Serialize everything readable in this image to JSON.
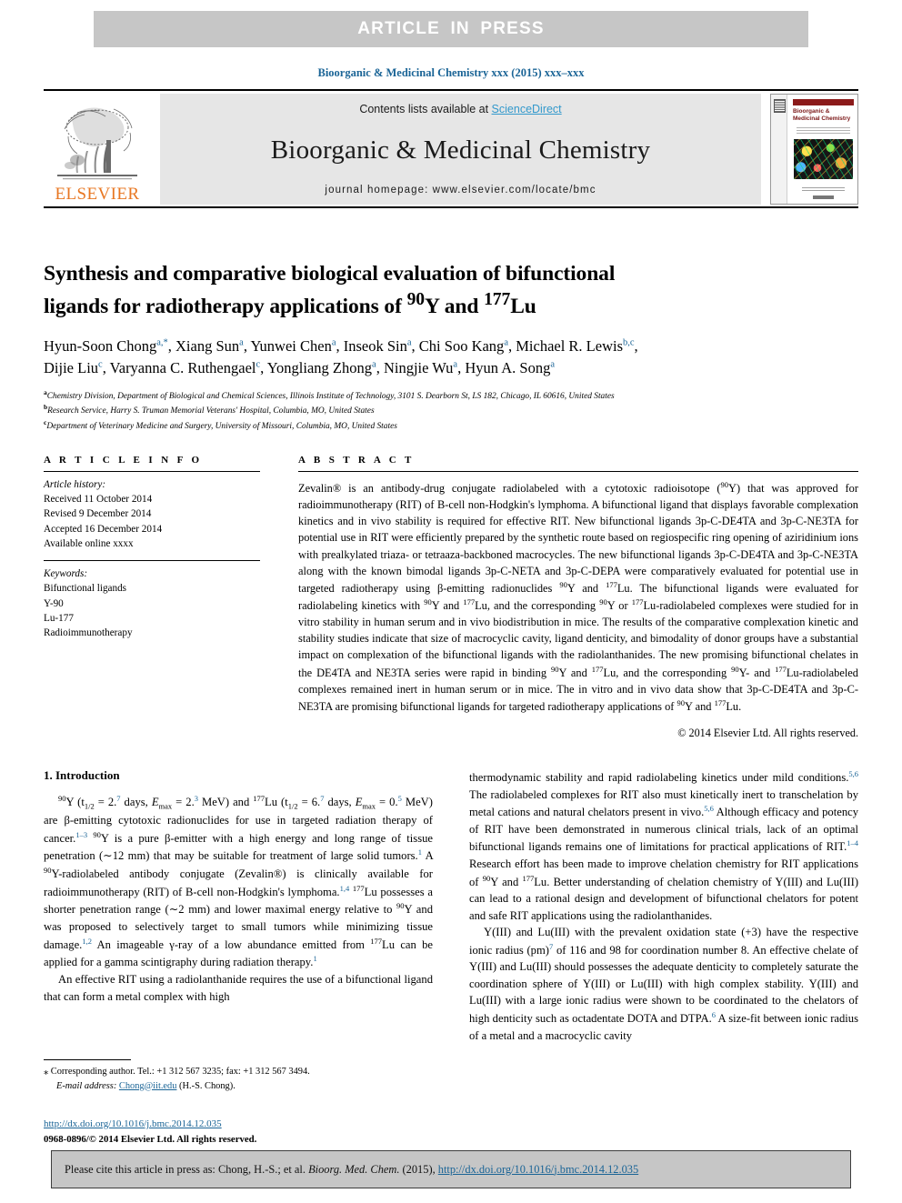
{
  "banner": {
    "text": "ARTICLE  IN  PRESS",
    "bg_color": "#c6c6c6",
    "text_color": "#ffffff"
  },
  "running_head": "Bioorganic & Medicinal Chemistry xxx (2015) xxx–xxx",
  "masthead": {
    "contents_prefix": "Contents lists available at ",
    "sciencedirect": "ScienceDirect",
    "journal_name": "Bioorganic & Medicinal Chemistry",
    "homepage_label": "journal homepage: www.elsevier.com/locate/bmc",
    "publisher_logo_text": "ELSEVIER",
    "publisher_logo_color": "#e87722",
    "cover": {
      "title": "Bioorganic & Medicinal Chemistry",
      "band_color": "#8b1a1a"
    }
  },
  "article": {
    "title_line1": "Synthesis and comparative biological evaluation of bifunctional",
    "title_line2_pre": "ligands for radiotherapy applications of ",
    "title_sup1": "90",
    "title_mid": "Y and ",
    "title_sup2": "177",
    "title_end": "Lu",
    "authors": [
      {
        "name": "Hyun-Soon Chong",
        "marks": "a,*"
      },
      {
        "name": "Xiang Sun",
        "marks": "a"
      },
      {
        "name": "Yunwei Chen",
        "marks": "a"
      },
      {
        "name": "Inseok Sin",
        "marks": "a"
      },
      {
        "name": "Chi Soo Kang",
        "marks": "a"
      },
      {
        "name": "Michael R. Lewis",
        "marks": "b,c"
      },
      {
        "name": "Dijie Liu",
        "marks": "c"
      },
      {
        "name": "Varyanna C. Ruthengael",
        "marks": "c"
      },
      {
        "name": "Yongliang Zhong",
        "marks": "a"
      },
      {
        "name": "Ningjie Wu",
        "marks": "a"
      },
      {
        "name": "Hyun A. Song",
        "marks": "a"
      }
    ],
    "affiliations": [
      {
        "mark": "a",
        "text": "Chemistry Division, Department of Biological and Chemical Sciences, Illinois Institute of Technology, 3101 S. Dearborn St, LS 182, Chicago, IL 60616, United States"
      },
      {
        "mark": "b",
        "text": "Research Service, Harry S. Truman Memorial Veterans' Hospital, Columbia, MO, United States"
      },
      {
        "mark": "c",
        "text": "Department of Veterinary Medicine and Surgery, University of Missouri, Columbia, MO, United States"
      }
    ]
  },
  "article_info": {
    "heading": "A R T I C L E   I N F O",
    "history_label": "Article history:",
    "history": [
      "Received 11 October 2014",
      "Revised 9 December 2014",
      "Accepted 16 December 2014",
      "Available online xxxx"
    ],
    "keywords_label": "Keywords:",
    "keywords": [
      "Bifunctional ligands",
      "Y-90",
      "Lu-177",
      "Radioimmunotherapy"
    ]
  },
  "abstract": {
    "heading": "A B S T R A C T",
    "body": "Zevalin® is an antibody-drug conjugate radiolabeled with a cytotoxic radioisotope (90Y) that was approved for radioimmunotherapy (RIT) of B-cell non-Hodgkin's lymphoma. A bifunctional ligand that displays favorable complexation kinetics and in vivo stability is required for effective RIT. New bifunctional ligands 3p-C-DE4TA and 3p-C-NE3TA for potential use in RIT were efficiently prepared by the synthetic route based on regiospecific ring opening of aziridinium ions with prealkylated triaza- or tetraaza-backboned macrocycles. The new bifunctional ligands 3p-C-DE4TA and 3p-C-NE3TA along with the known bimodal ligands 3p-C-NETA and 3p-C-DEPA were comparatively evaluated for potential use in targeted radiotherapy using β-emitting radionuclides 90Y and 177Lu. The bifunctional ligands were evaluated for radiolabeling kinetics with 90Y and 177Lu, and the corresponding 90Y or 177Lu-radiolabeled complexes were studied for in vitro stability in human serum and in vivo biodistribution in mice. The results of the comparative complexation kinetic and stability studies indicate that size of macrocyclic cavity, ligand denticity, and bimodality of donor groups have a substantial impact on complexation of the bifunctional ligands with the radiolanthanides. The new promising bifunctional chelates in the DE4TA and NE3TA series were rapid in binding 90Y and 177Lu, and the corresponding 90Y- and 177Lu-radiolabeled complexes remained inert in human serum or in mice. The in vitro and in vivo data show that 3p-C-DE4TA and 3p-C-NE3TA are promising bifunctional ligands for targeted radiotherapy applications of 90Y and 177Lu.",
    "copyright": "© 2014 Elsevier Ltd. All rights reserved."
  },
  "introduction": {
    "section_number_title": "1. Introduction",
    "left_para1": "90Y (t1/2 = 2.7 days, Emax = 2.3 MeV) and 177Lu (t1/2 = 6.7 days, Emax = 0.5 MeV) are β-emitting cytotoxic radionuclides for use in targeted radiation therapy of cancer.1–3 90Y is a pure β-emitter with a high energy and long range of tissue penetration (∼12 mm) that may be suitable for treatment of large solid tumors.1 A 90Y-radiolabeled antibody conjugate (Zevalin®) is clinically available for radioimmunotherapy (RIT) of B-cell non-Hodgkin's lymphoma.1,4 177Lu possesses a shorter penetration range (∼2 mm) and lower maximal energy relative to 90Y and was proposed to selectively target to small tumors while minimizing tissue damage.1,2 An imageable γ-ray of a low abundance emitted from 177Lu can be applied for a gamma scintigraphy during radiation therapy.1",
    "left_para2": "An effective RIT using a radiolanthanide requires the use of a bifunctional ligand that can form a metal complex with high",
    "right_para1": "thermodynamic stability and rapid radiolabeling kinetics under mild conditions.5,6 The radiolabeled complexes for RIT also must kinetically inert to transchelation by metal cations and natural chelators present in vivo.5,6 Although efficacy and potency of RIT have been demonstrated in numerous clinical trials, lack of an optimal bifunctional ligands remains one of limitations for practical applications of RIT.1–4 Research effort has been made to improve chelation chemistry for RIT applications of 90Y and 177Lu. Better understanding of chelation chemistry of Y(III) and Lu(III) can lead to a rational design and development of bifunctional chelators for potent and safe RIT applications using the radiolanthanides.",
    "right_para2": "Y(III) and Lu(III) with the prevalent oxidation state (+3) have the respective ionic radius (pm)7 of 116 and 98 for coordination number 8. An effective chelate of Y(III) and Lu(III) should possesses the adequate denticity to completely saturate the coordination sphere of Y(III) or Lu(III) with high complex stability. Y(III) and Lu(III) with a large ionic radius were shown to be coordinated to the chelators of high denticity such as octadentate DOTA and DTPA.6 A size-fit between ionic radius of a metal and a macrocyclic cavity"
  },
  "footnote": {
    "corresponding": "Corresponding author. Tel.: +1 312 567 3235; fax: +1 312 567 3494.",
    "email_label": "E-mail address:",
    "email": "Chong@iit.edu",
    "email_owner": "(H.-S. Chong)."
  },
  "doi_block": {
    "doi": "http://dx.doi.org/10.1016/j.bmc.2014.12.035",
    "issn": "0968-0896/© 2014 Elsevier Ltd. All rights reserved."
  },
  "cite_box": {
    "prefix": "Please cite this article in press as: Chong, H.-S.; et al. ",
    "journal": "Bioorg. Med. Chem.",
    "year": " (2015), ",
    "url": "http://dx.doi.org/10.1016/j.bmc.2014.12.035"
  },
  "colors": {
    "link_blue": "#1a6496",
    "sciencedirect_blue": "#3399cc",
    "elsevier_orange": "#e87722",
    "banner_gray": "#c6c6c6",
    "masthead_gray": "#e6e6e6"
  }
}
